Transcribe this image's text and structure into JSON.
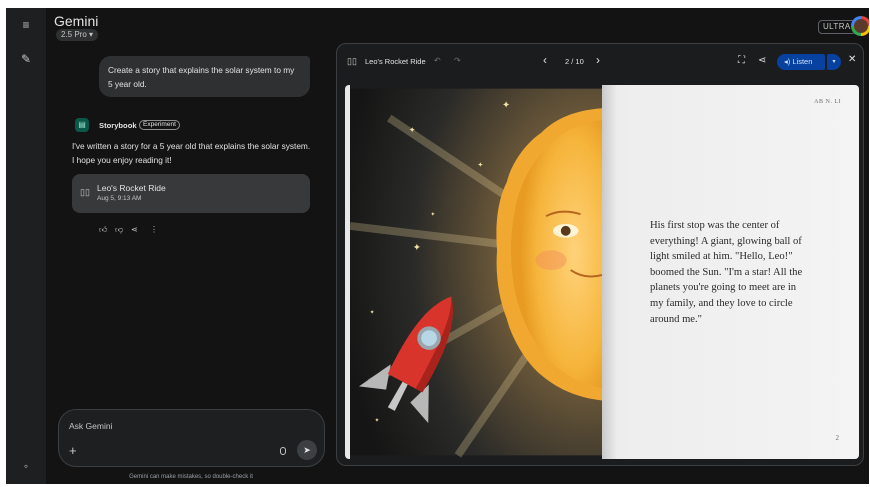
{
  "app": {
    "title": "Gemini",
    "model": "2.5 Pro ▾",
    "tier": "ULTRA"
  },
  "chat": {
    "prompt": "Create a story that explains the solar system to my 5 year old.",
    "tool_name": "Storybook",
    "tool_badge": "Experiment",
    "response": "I've written a story for a 5 year old that explains the solar system. I hope you enjoy reading it!",
    "card": {
      "title": "Leo's Rocket Ride",
      "date": "Aug 5, 9:13 AM"
    }
  },
  "input": {
    "placeholder": "Ask Gemini"
  },
  "disclaimer": "Gemini can make mistakes, so double-check it",
  "viewer": {
    "title": "Leo's Rocket Ride",
    "page_indicator": "2 / 10",
    "listen_label": "Listen",
    "running_head": "AB N. LI",
    "page_number": "2",
    "story_text": "His first stop was the center of everything! A giant, glowing ball of light smiled at him. \"Hello, Leo!\" boomed the Sun. \"I'm a star! All the planets you're going to meet are in my family, and they love to circle around me.\""
  },
  "icons": [
    "menu-icon",
    "edit-icon",
    "settings-icon",
    "book-icon",
    "thumb-up-icon",
    "thumb-down-icon",
    "share-icon",
    "more-icon",
    "plus-icon",
    "mic-icon",
    "send-icon",
    "undo-icon",
    "redo-icon",
    "chevron-left-icon",
    "chevron-right-icon",
    "fullscreen-icon",
    "speaker-icon",
    "chevron-down-icon",
    "close-icon"
  ]
}
